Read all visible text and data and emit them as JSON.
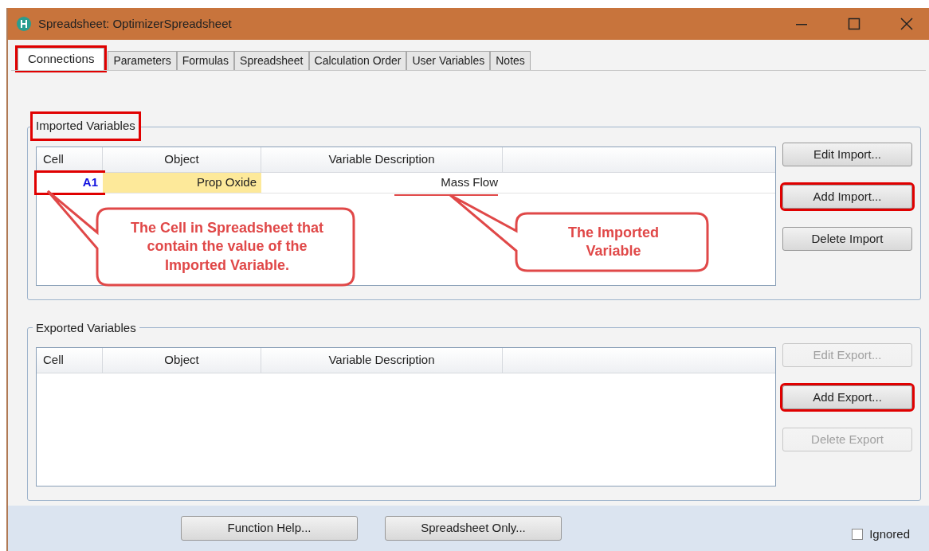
{
  "window": {
    "title": "Spreadsheet: OptimizerSpreadsheet"
  },
  "tabs": [
    {
      "label": "Connections",
      "selected": true,
      "highlighted": true
    },
    {
      "label": "Parameters",
      "selected": false,
      "highlighted": false
    },
    {
      "label": "Formulas",
      "selected": false,
      "highlighted": false
    },
    {
      "label": "Spreadsheet",
      "selected": false,
      "highlighted": false
    },
    {
      "label": "Calculation Order",
      "selected": false,
      "highlighted": false
    },
    {
      "label": "User Variables",
      "selected": false,
      "highlighted": false
    },
    {
      "label": "Notes",
      "selected": false,
      "highlighted": false
    }
  ],
  "groups": [
    {
      "title": "Imported Variables",
      "highlighted": true,
      "columns": [
        "Cell",
        "Object",
        "Variable Description"
      ],
      "rows": [
        {
          "cell": "A1",
          "object": "Prop Oxide",
          "description": "Mass Flow",
          "highlighted": true
        }
      ],
      "buttons": [
        {
          "label": "Edit Import...",
          "disabled": false,
          "highlighted": false
        },
        {
          "label": "Add Import...",
          "disabled": false,
          "highlighted": true
        },
        {
          "label": "Delete Import",
          "disabled": false,
          "highlighted": false
        }
      ]
    },
    {
      "title": "Exported Variables",
      "highlighted": false,
      "columns": [
        "Cell",
        "Object",
        "Variable Description"
      ],
      "buttons": [
        {
          "label": "Edit Export...",
          "disabled": true,
          "highlighted": false
        },
        {
          "label": "Add Export...",
          "disabled": false,
          "highlighted": true
        },
        {
          "label": "Delete Export",
          "disabled": true,
          "highlighted": false
        }
      ]
    }
  ],
  "footer": {
    "buttons": [
      "Function Help...",
      "Spreadsheet Only..."
    ],
    "ignored": {
      "label": "Ignored",
      "checked": false
    }
  },
  "callouts": [
    {
      "text": "The Cell in Spreadsheet that contain the value of the Imported Variable."
    },
    {
      "text": "The Imported Variable"
    }
  ]
}
